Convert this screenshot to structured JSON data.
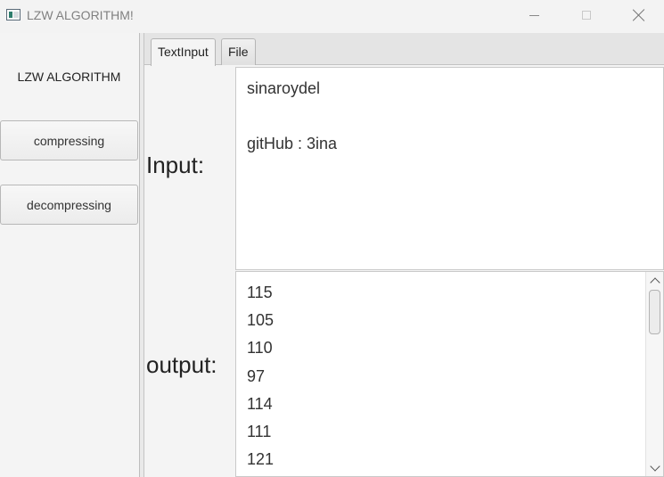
{
  "window": {
    "title": "LZW ALGORITHM!"
  },
  "sidebar": {
    "title": "LZW ALGORITHM",
    "buttons": {
      "compress": "compressing",
      "decompress": "decompressing"
    }
  },
  "tabs": [
    {
      "label": "TextInput",
      "selected": true
    },
    {
      "label": "File",
      "selected": false
    }
  ],
  "main": {
    "input_label": "Input:",
    "output_label": "output:",
    "input_text": "sinaroydel\n\ngitHub : 3ina",
    "output_values": [
      "115",
      "105",
      "110",
      "97",
      "114",
      "111",
      "121"
    ]
  }
}
